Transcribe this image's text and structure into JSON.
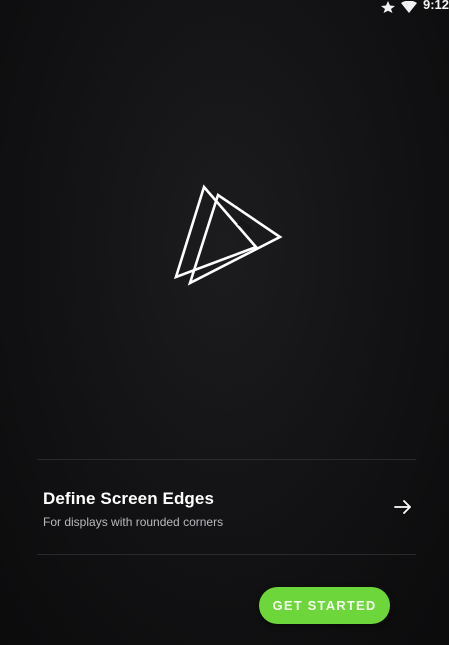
{
  "status_bar": {
    "time": "9:12",
    "icons": [
      "signal-icon",
      "wifi-icon"
    ]
  },
  "logo": {
    "icon": "play-triangle-logo-icon",
    "stroke_color": "#ffffff"
  },
  "feature": {
    "title": "Define Screen Edges",
    "subtitle": "For displays with rounded corners",
    "action_icon": "arrow-right-icon"
  },
  "cta": {
    "label": "GET STARTED",
    "color": "#6cd63a"
  }
}
